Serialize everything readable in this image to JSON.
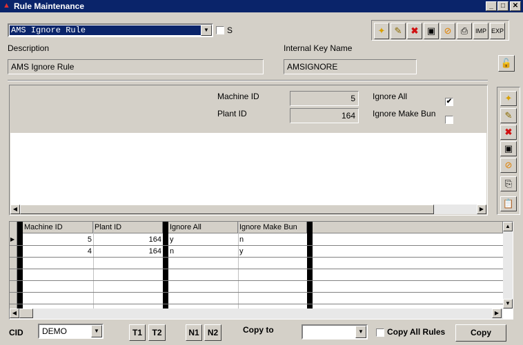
{
  "window": {
    "title": "Rule Maintenance",
    "minimize": "_",
    "maximize": "□",
    "close": "✕"
  },
  "rule_select": {
    "value": "AMS Ignore Rule",
    "s_label": "S"
  },
  "description": {
    "label": "Description",
    "value": "AMS Ignore Rule"
  },
  "internal_key": {
    "label": "Internal Key Name",
    "value": "AMSIGNORE"
  },
  "toolbar": {
    "imp": "IMP",
    "exp": "EXP"
  },
  "detail": {
    "machine_id_label": "Machine ID",
    "machine_id": "5",
    "plant_id_label": "Plant ID",
    "plant_id": "164",
    "ignore_all_label": "Ignore All",
    "ignore_all_checked": true,
    "ignore_make_bun_label": "Ignore Make Bun",
    "ignore_make_bun_checked": false
  },
  "grid": {
    "columns": [
      "Machine ID",
      "Plant ID",
      "Ignore All",
      "Ignore Make Bun"
    ],
    "rows": [
      {
        "machine_id": "5",
        "plant_id": "164",
        "ignore_all": "y",
        "ignore_make_bun": "n"
      },
      {
        "machine_id": "4",
        "plant_id": "164",
        "ignore_all": "n",
        "ignore_make_bun": "y"
      }
    ]
  },
  "bottom": {
    "cid_label": "CID",
    "cid_value": "DEMO",
    "t1": "T1",
    "t2": "T2",
    "n1": "N1",
    "n2": "N2",
    "copy_to_label": "Copy to",
    "copy_to_value": "",
    "copy_all_rules_label": "Copy All Rules",
    "copy_button": "Copy"
  }
}
